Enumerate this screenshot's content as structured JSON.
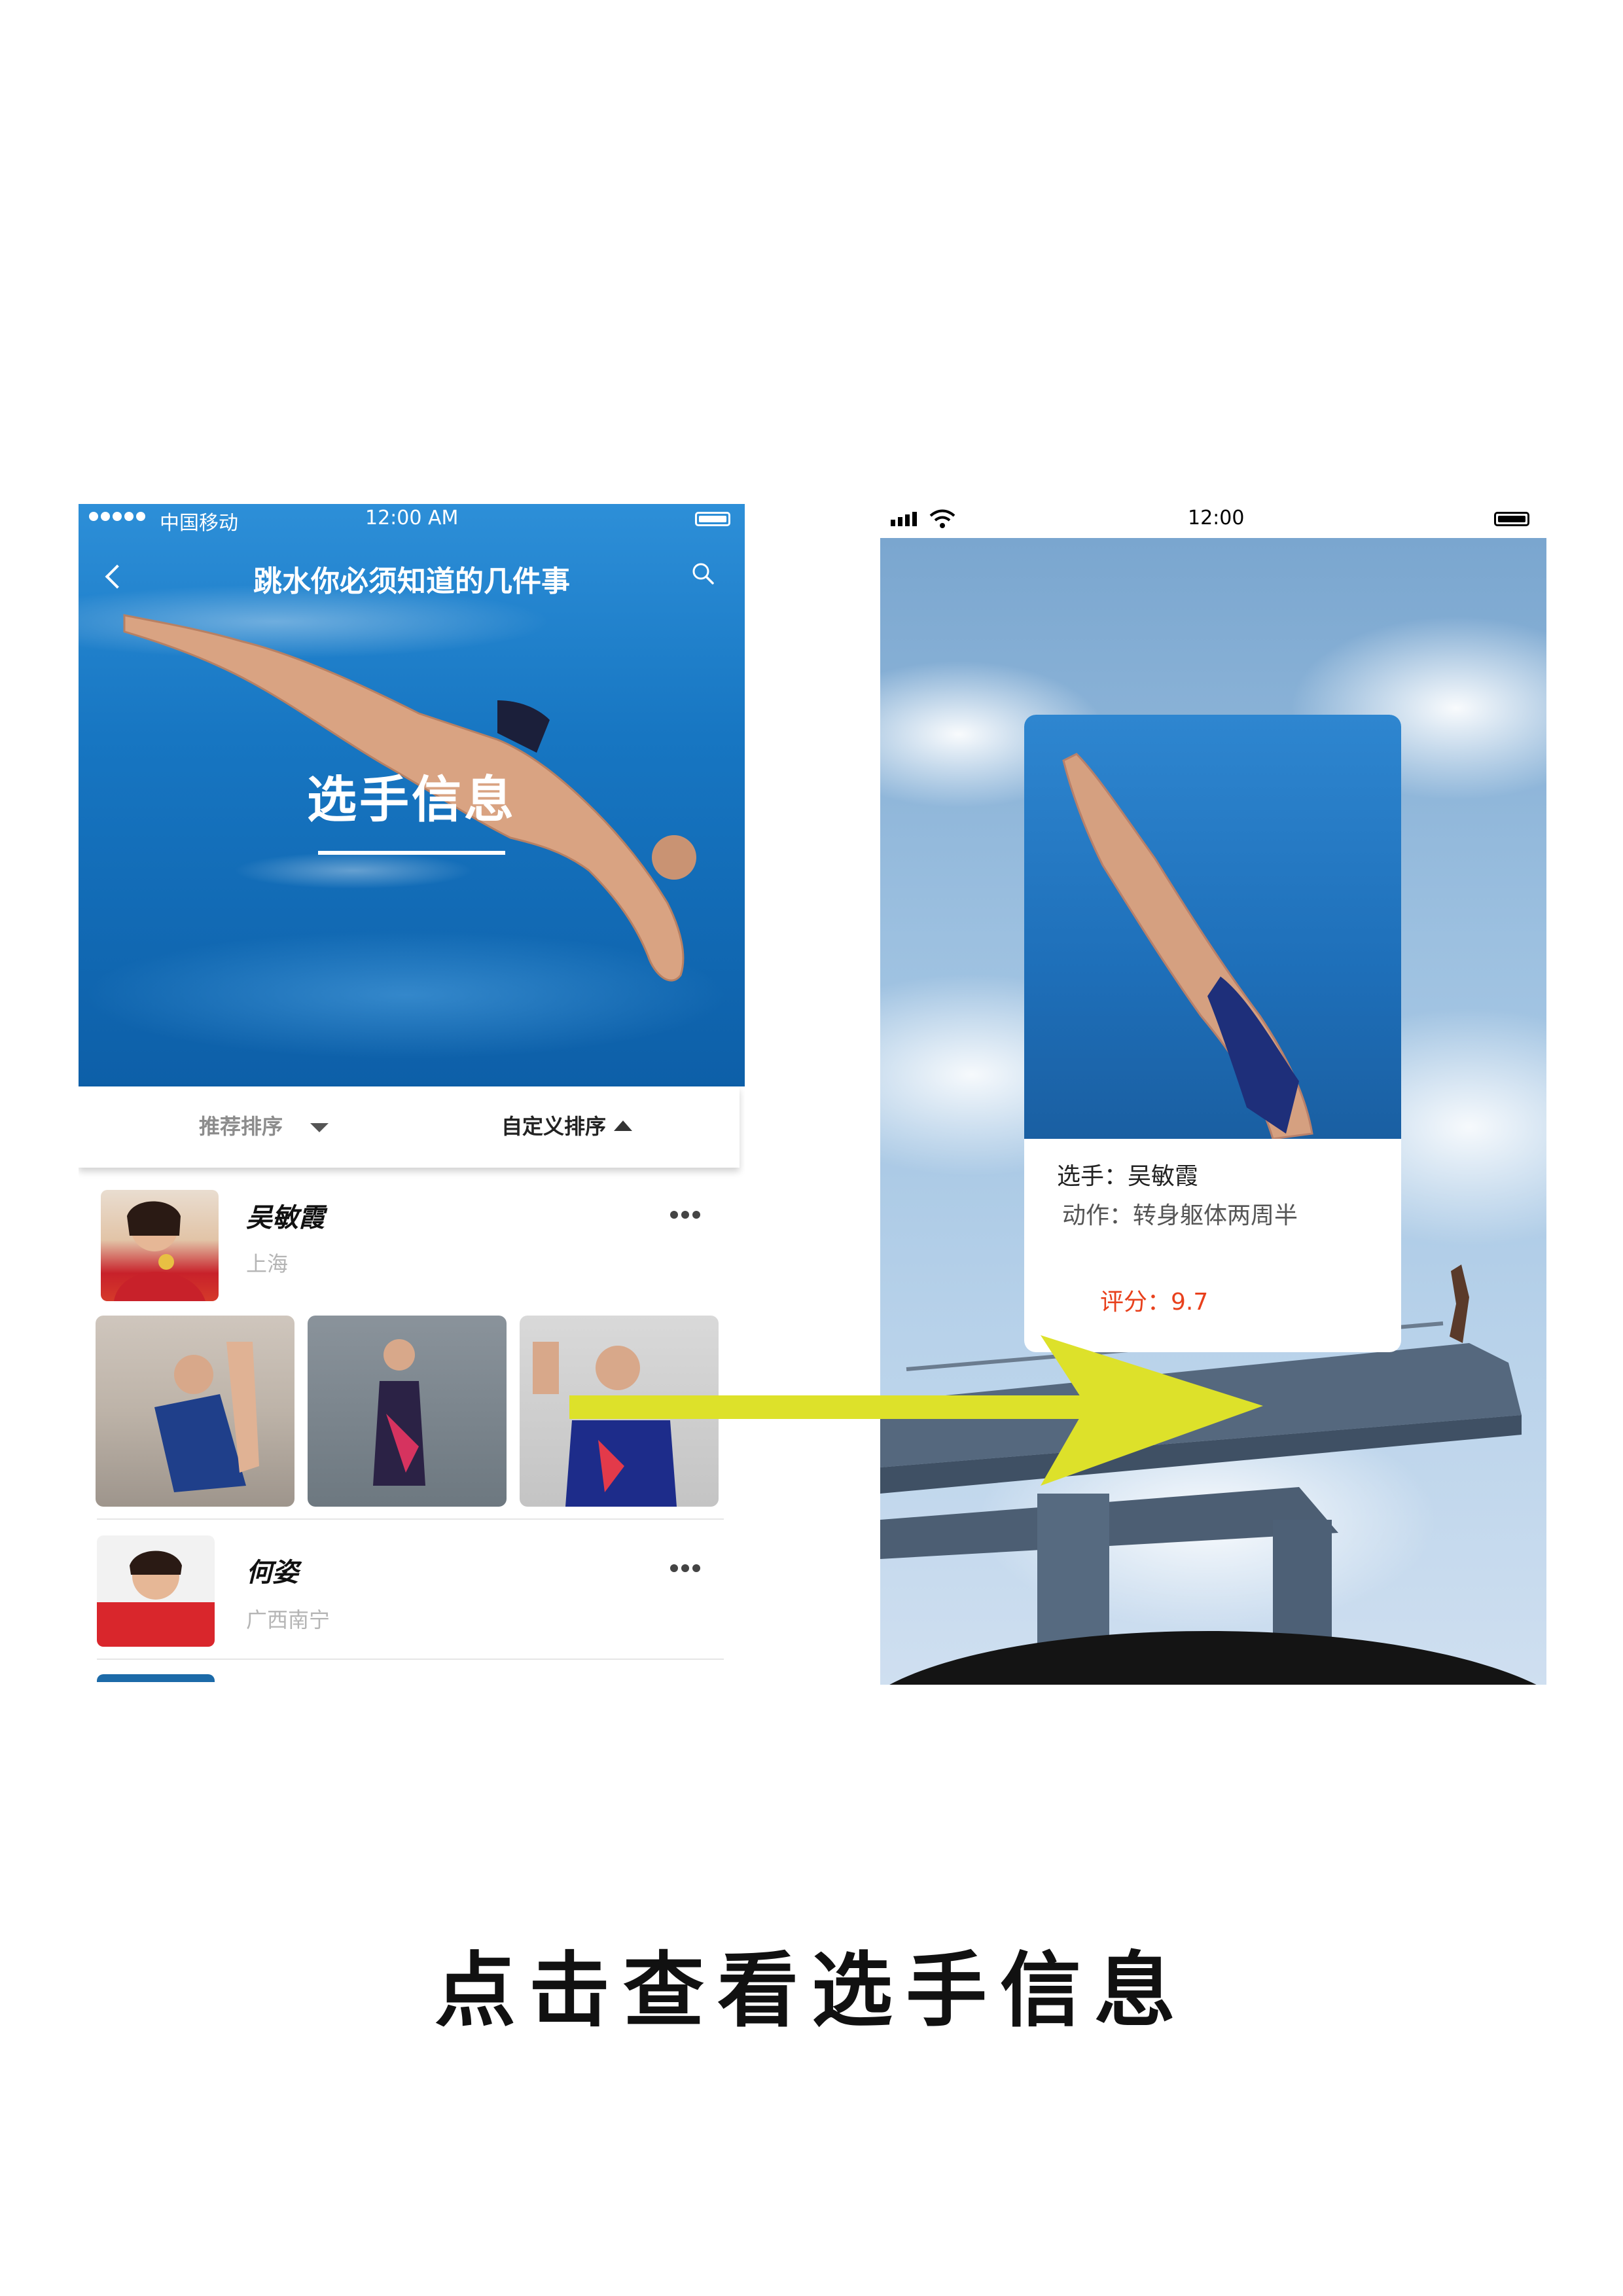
{
  "left_phone": {
    "status": {
      "carrier": "中国移动",
      "time": "12:00 AM"
    },
    "nav_title": "跳水你必须知道的几件事",
    "hero_title": "选手信息",
    "sort": {
      "recommended": "推荐排序",
      "custom": "自定义排序"
    },
    "athletes": [
      {
        "name": "吴敏霞",
        "location": "上海"
      },
      {
        "name": "何姿",
        "location": "广西南宁"
      }
    ]
  },
  "right_phone": {
    "status": {
      "time": "12:00"
    },
    "card": {
      "player_line": "选手：吴敏霞",
      "action_line": "动作：转身躯体两周半",
      "score_line": "评分：9.7"
    }
  },
  "caption": "点击查看选手信息",
  "colors": {
    "arrow": "#dde12a",
    "score": "#e8401c",
    "hero_blue": "#1776c2"
  }
}
